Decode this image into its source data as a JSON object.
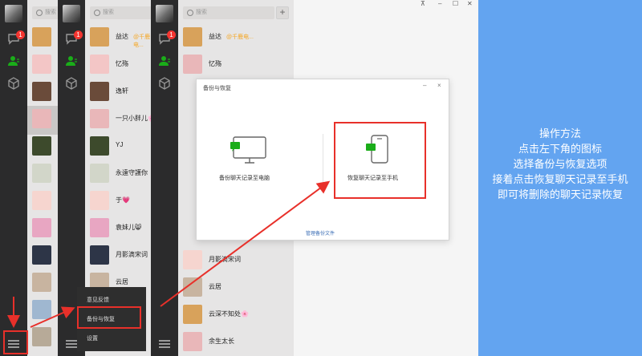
{
  "search": {
    "placeholder": "搜索"
  },
  "contacts_panel1": [
    {
      "name": ""
    },
    {
      "name": ""
    },
    {
      "name": ""
    },
    {
      "name": ""
    },
    {
      "name": ""
    },
    {
      "name": ""
    },
    {
      "name": ""
    },
    {
      "name": ""
    },
    {
      "name": ""
    },
    {
      "name": ""
    },
    {
      "name": ""
    },
    {
      "name": ""
    }
  ],
  "contacts_panel2": [
    {
      "name": "益达",
      "sub": "@千鹿电..."
    },
    {
      "name": "忆殇"
    },
    {
      "name": "逸轩"
    },
    {
      "name": "一只小胖儿🌸"
    },
    {
      "name": "YJ"
    },
    {
      "name": "永遠守護你"
    },
    {
      "name": "于💗"
    },
    {
      "name": "袁妹儿😸"
    },
    {
      "name": "月影滴宋词"
    },
    {
      "name": "云居"
    }
  ],
  "contacts_panel3": [
    {
      "name": "益达",
      "sub": "@千鹿电..."
    },
    {
      "name": "忆殇"
    },
    {
      "name": "月影滴宋词"
    },
    {
      "name": "云居"
    },
    {
      "name": "云深不知处🌸"
    },
    {
      "name": "余生太长"
    }
  ],
  "badges": {
    "messages": "1"
  },
  "popup_menu": {
    "feedback": "意见反馈",
    "backup_restore": "备份与恢复",
    "settings": "设置"
  },
  "dialog": {
    "title": "备份与恢复",
    "minimize": "–",
    "close": "×",
    "backup_to_pc": "备份聊天记录至电脑",
    "restore_to_phone": "恢复聊天记录至手机",
    "manage_files": "管理备份文件"
  },
  "window_controls": {
    "pin": "⊼",
    "minimize": "–",
    "maximize": "☐",
    "close": "✕"
  },
  "instructions": {
    "line1": "操作方法",
    "line2": "点击左下角的图标",
    "line3": "选择备份与恢复选项",
    "line4": "接着点击恢复聊天记录至手机",
    "line5": "即可将删除的聊天记录恢复"
  },
  "colors": {
    "highlight": "#e8302a",
    "sidebar": "#2b2b2c",
    "list_bg": "#e6e5e5",
    "accent_green": "#1aad19",
    "background_blue": "#63a4f0"
  }
}
